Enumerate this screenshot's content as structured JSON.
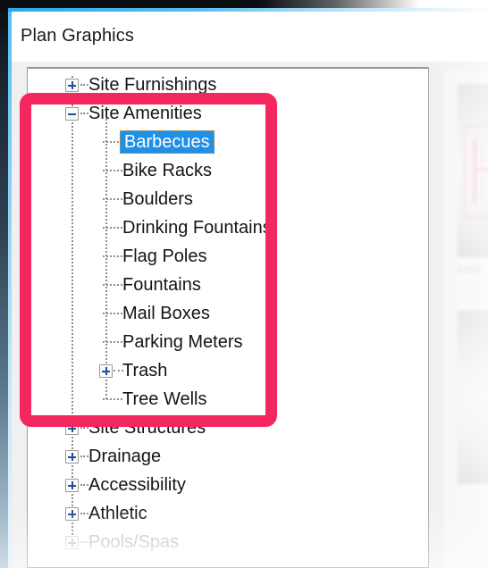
{
  "window": {
    "title": "Plan Graphics",
    "accent_blue": "#56bdee",
    "chrome_dark": "#0c0f12"
  },
  "annotation": {
    "name": "highlight-rectangle",
    "color": "#f4265e",
    "targets": "Site Amenities subtree"
  },
  "tree": {
    "name": "plan-graphics-category-tree",
    "selected": "Barbecues",
    "selection_bg": "#1e90e8",
    "selection_fg": "#ffffff",
    "rows": [
      {
        "label": "Site Furnishings",
        "level": 1,
        "expander": "plus",
        "faded": false,
        "selected": false
      },
      {
        "label": "Site Amenities",
        "level": 1,
        "expander": "minus",
        "faded": false,
        "selected": false
      },
      {
        "label": "Barbecues",
        "level": 2,
        "expander": "none",
        "faded": false,
        "selected": true
      },
      {
        "label": "Bike Racks",
        "level": 2,
        "expander": "none",
        "faded": false,
        "selected": false
      },
      {
        "label": "Boulders",
        "level": 2,
        "expander": "none",
        "faded": false,
        "selected": false
      },
      {
        "label": "Drinking Fountains",
        "level": 2,
        "expander": "none",
        "faded": false,
        "selected": false
      },
      {
        "label": "Flag Poles",
        "level": 2,
        "expander": "none",
        "faded": false,
        "selected": false
      },
      {
        "label": "Fountains",
        "level": 2,
        "expander": "none",
        "faded": false,
        "selected": false
      },
      {
        "label": "Mail Boxes",
        "level": 2,
        "expander": "none",
        "faded": false,
        "selected": false
      },
      {
        "label": "Parking Meters",
        "level": 2,
        "expander": "none",
        "faded": false,
        "selected": false
      },
      {
        "label": "Trash",
        "level": 2,
        "expander": "plus",
        "faded": false,
        "selected": false
      },
      {
        "label": "Tree Wells",
        "level": 2,
        "expander": "none",
        "faded": false,
        "selected": false
      },
      {
        "label": "Site Structures",
        "level": 1,
        "expander": "plus",
        "faded": false,
        "selected": false
      },
      {
        "label": "Drainage",
        "level": 1,
        "expander": "plus",
        "faded": false,
        "selected": false
      },
      {
        "label": "Accessibility",
        "level": 1,
        "expander": "plus",
        "faded": false,
        "selected": false
      },
      {
        "label": "Athletic",
        "level": 1,
        "expander": "plus",
        "faded": false,
        "selected": false
      },
      {
        "label": "Pools/Spas",
        "level": 1,
        "expander": "plus",
        "faded": true,
        "selected": false
      }
    ]
  },
  "preview": {
    "name": "symbol-preview-list",
    "items": [
      {
        "caption": "AME"
      },
      {
        "caption": ""
      }
    ]
  }
}
